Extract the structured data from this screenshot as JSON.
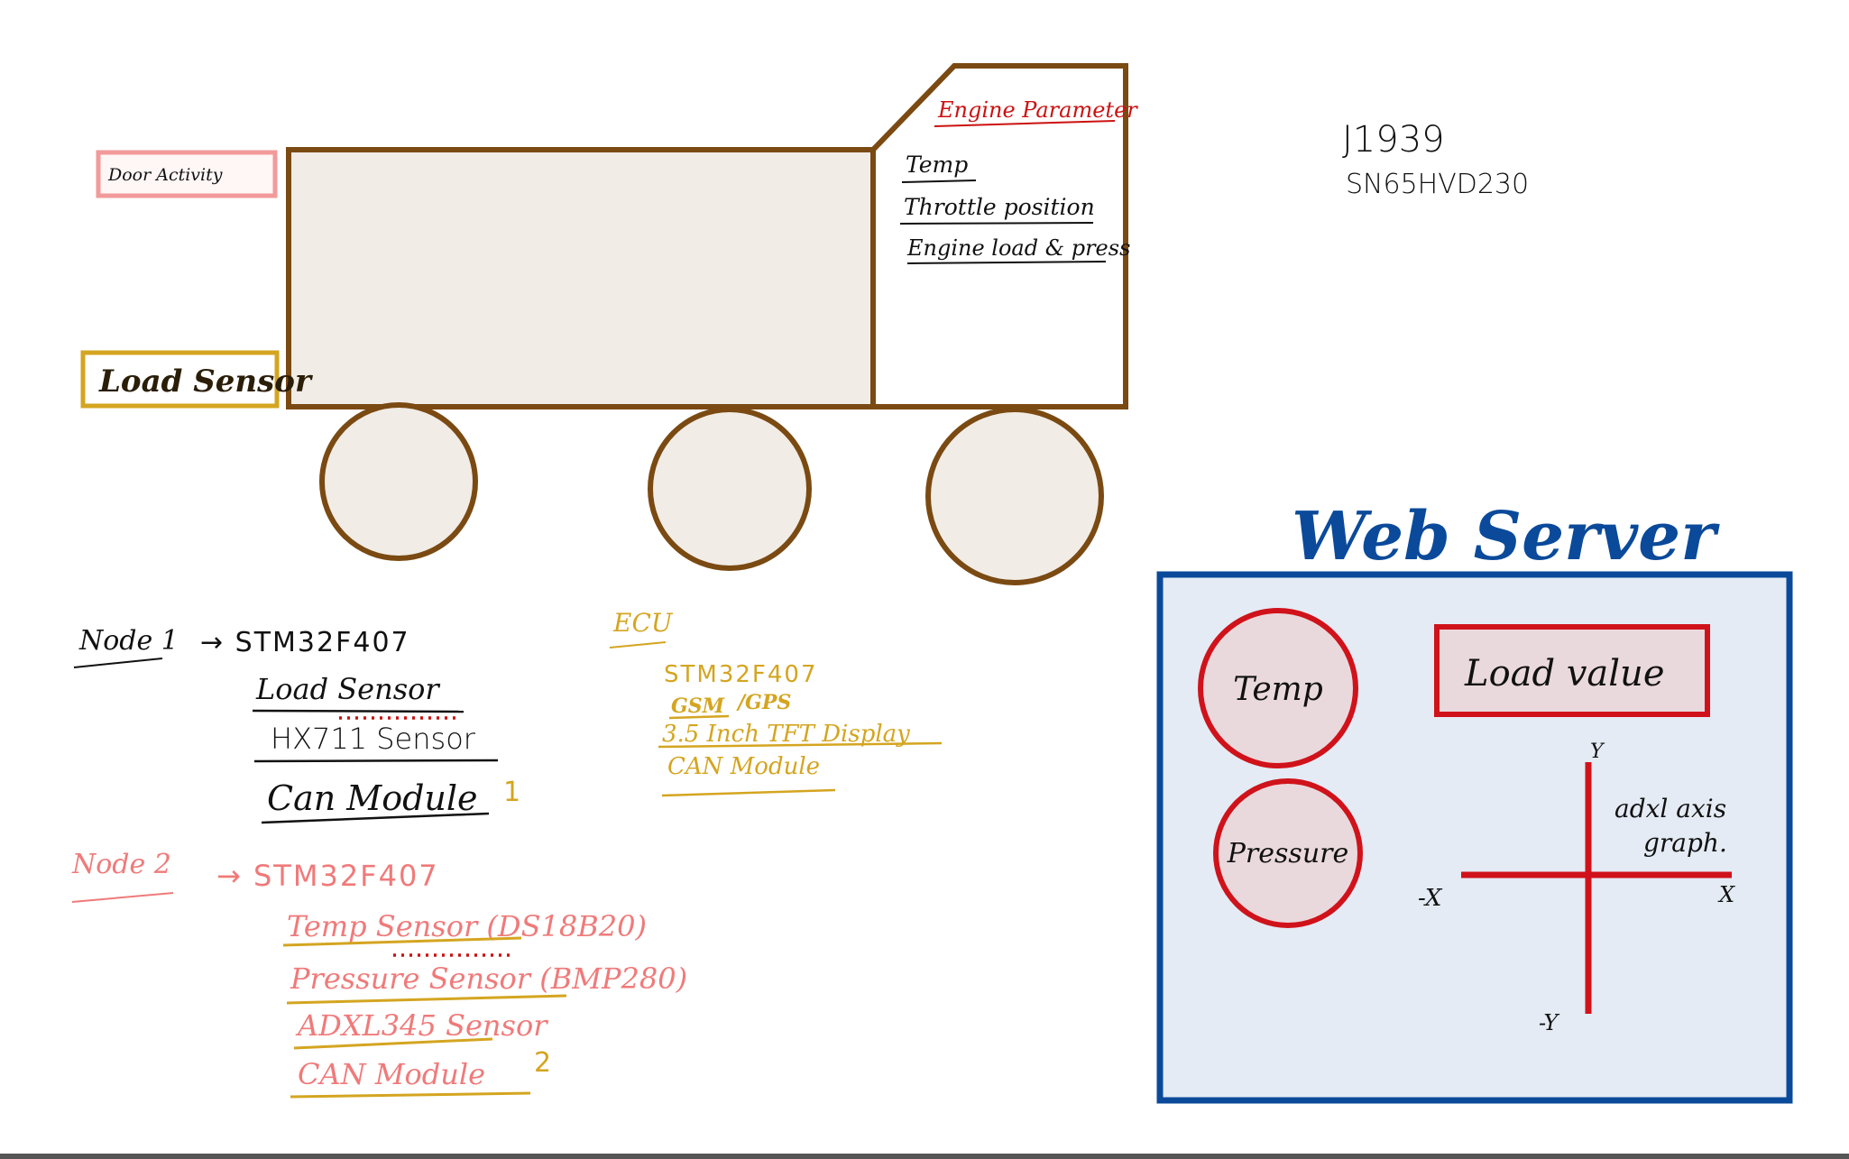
{
  "truck": {
    "door_label": "Door Activity",
    "load_label": "Load Sensor",
    "cab_title": "Engine Parameter",
    "cab_items": [
      "Temp",
      "Throttle position",
      "Engine load & press"
    ]
  },
  "protocol": {
    "line1": "J1939",
    "line2": "SN65HVD230"
  },
  "node1": {
    "label": "Node 1",
    "mcu": "→ STM32F407",
    "items": [
      "Load Sensor",
      "HX711 Sensor",
      "Can Module"
    ],
    "suffix": "1"
  },
  "node2": {
    "label": "Node 2",
    "mcu": "→ STM32F407",
    "items": [
      "Temp Sensor (DS18B20)",
      "Pressure Sensor (BMP280)",
      "ADXL345 Sensor",
      "CAN Module"
    ],
    "suffix": "2"
  },
  "ecu": {
    "label": "ECU",
    "mcu": "STM32F407",
    "gsm": "GSM",
    "gps": "/GPS",
    "items": [
      "3.5 Inch TFT Display",
      "CAN Module"
    ]
  },
  "web": {
    "title": "Web Server",
    "temp_label": "Temp",
    "pressure_label": "Pressure",
    "load_value_label": "Load value",
    "axis_note_line1": "adxl axis",
    "axis_note_line2": "graph.",
    "axis_plus_y": "Y",
    "axis_minus_y": "-Y",
    "axis_plus_x": "X",
    "axis_minus_x": "-X"
  },
  "colors": {
    "truck_outline": "#7a4a12",
    "truck_fill": "#f1ece6",
    "door_box": "#f29a9a",
    "load_box": "#d4a520",
    "engine_title": "#cc1111",
    "server_blue": "#0b4a9a",
    "server_fill": "#e4ebf4",
    "server_red": "#d0121b",
    "server_item_fill": "#ead9dc",
    "node2_pink": "#f07a7a",
    "ecu_gold": "#d4a520",
    "ink": "#111111"
  }
}
